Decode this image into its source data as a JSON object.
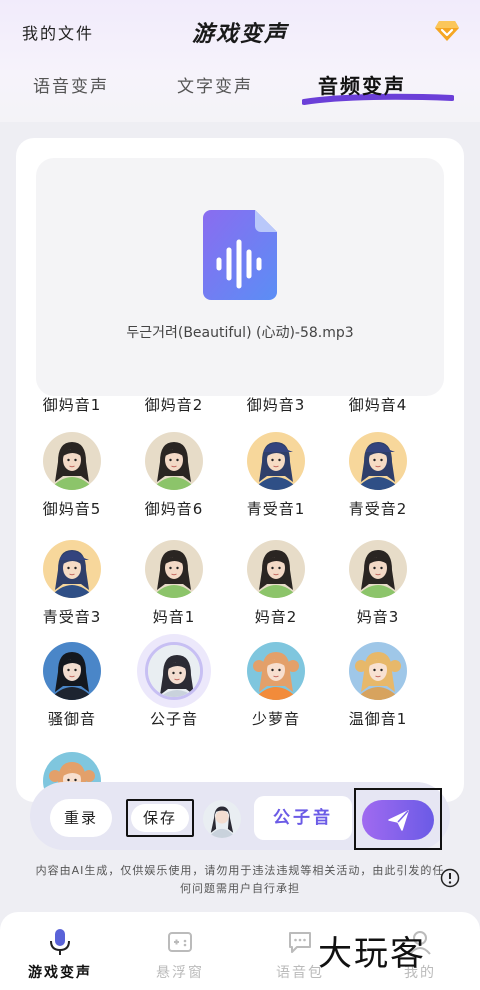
{
  "header": {
    "my_files": "我的文件",
    "title": "游戏变声",
    "vip_icon": "diamond-icon",
    "accent_color": "#f5a623"
  },
  "tabs": [
    {
      "label": "语音变声",
      "active": false
    },
    {
      "label": "文字变声",
      "active": false
    },
    {
      "label": "音频变声",
      "active": true
    }
  ],
  "file": {
    "icon": "audio-file-icon",
    "name": "두근거려(Beautiful) (心动)-58.mp3"
  },
  "voices": [
    {
      "label": "御妈音1",
      "type": "woman"
    },
    {
      "label": "御妈音2",
      "type": "woman"
    },
    {
      "label": "御妈音3",
      "type": "woman"
    },
    {
      "label": "御妈音4",
      "type": "woman"
    },
    {
      "label": "御妈音5",
      "type": "woman"
    },
    {
      "label": "御妈音6",
      "type": "woman"
    },
    {
      "label": "青受音1",
      "type": "boy"
    },
    {
      "label": "青受音2",
      "type": "boy"
    },
    {
      "label": "青受音3",
      "type": "boy"
    },
    {
      "label": "妈音1",
      "type": "woman"
    },
    {
      "label": "妈音2",
      "type": "woman"
    },
    {
      "label": "妈音3",
      "type": "woman"
    },
    {
      "label": "骚御音",
      "type": "darkgirl"
    },
    {
      "label": "公子音",
      "type": "prince",
      "selected": true
    },
    {
      "label": "少萝音",
      "type": "loli"
    },
    {
      "label": "温御音1",
      "type": "blonde"
    },
    {
      "label": "",
      "type": "loli"
    }
  ],
  "actions": {
    "redo": "重录",
    "save": "保存",
    "selected_voice": "公子音",
    "send_icon": "send-icon",
    "accent": "#6b5be6"
  },
  "disclaimer": "内容由AI生成，仅供娱乐使用，请勿用于违法违规等相关活动，由此引发的任何问题需用户自行承担",
  "nav": [
    {
      "label": "游戏变声",
      "icon": "mic-icon",
      "active": true
    },
    {
      "label": "悬浮窗",
      "icon": "gamepad-icon",
      "active": false
    },
    {
      "label": "语音包",
      "icon": "chat-icon",
      "active": false
    },
    {
      "label": "我的",
      "icon": "user-icon",
      "active": false
    }
  ],
  "watermark": "大玩客"
}
